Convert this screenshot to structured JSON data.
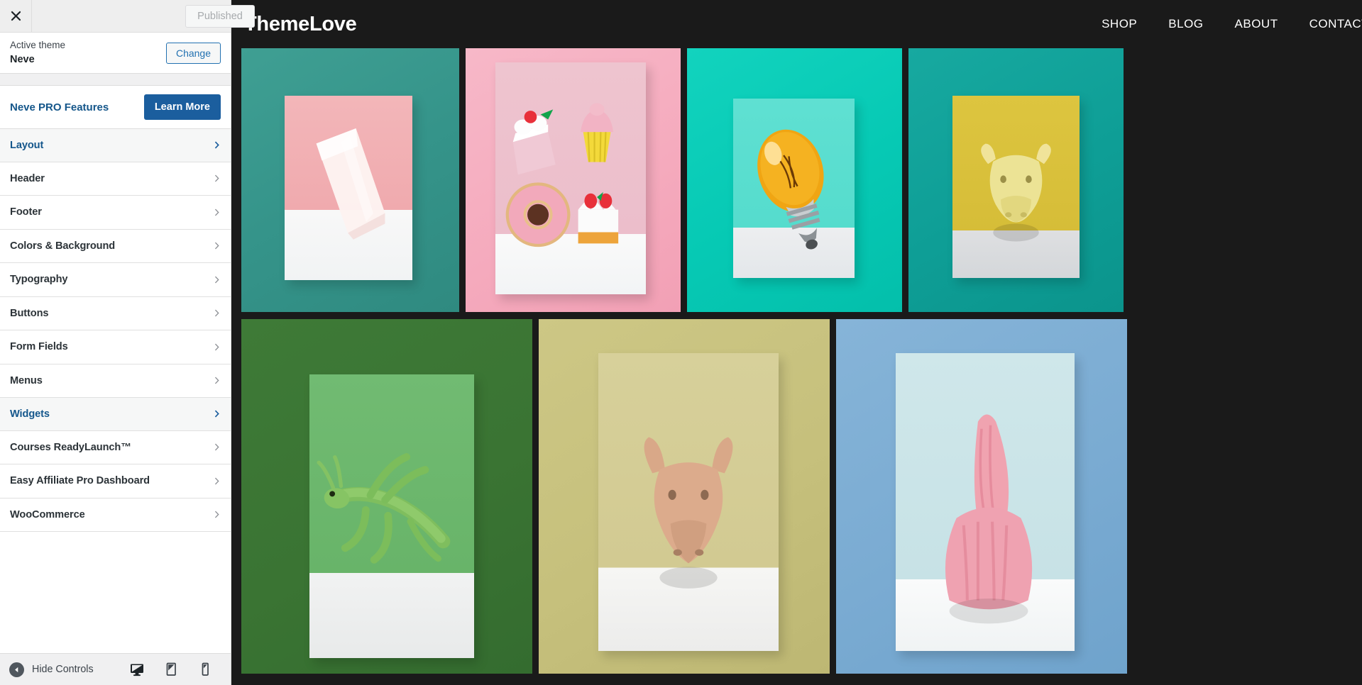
{
  "customizer": {
    "close_icon": "close-x-icon",
    "publish_button": "Published",
    "theme": {
      "label": "Active theme",
      "name": "Neve",
      "change_button": "Change"
    },
    "pro": {
      "label": "Neve PRO Features",
      "button": "Learn More"
    },
    "sections": [
      {
        "label": "Layout",
        "active": true
      },
      {
        "label": "Header",
        "active": false
      },
      {
        "label": "Footer",
        "active": false
      },
      {
        "label": "Colors & Background",
        "active": false
      },
      {
        "label": "Typography",
        "active": false
      },
      {
        "label": "Buttons",
        "active": false
      },
      {
        "label": "Form Fields",
        "active": false
      },
      {
        "label": "Menus",
        "active": false
      },
      {
        "label": "Widgets",
        "active": true
      },
      {
        "label": "Courses ReadyLaunch™",
        "active": false
      },
      {
        "label": "Easy Affiliate Pro Dashboard",
        "active": false
      },
      {
        "label": "WooCommerce",
        "active": false
      }
    ],
    "footer": {
      "hide_controls": "Hide Controls",
      "devices": [
        {
          "name": "desktop-preview-icon",
          "selected": true
        },
        {
          "name": "tablet-preview-icon",
          "selected": false
        },
        {
          "name": "mobile-preview-icon",
          "selected": false
        }
      ]
    }
  },
  "preview": {
    "site_title": "ThemeLove",
    "nav": [
      {
        "label": "SHOP"
      },
      {
        "label": "BLOG"
      },
      {
        "label": "ABOUT"
      },
      {
        "label": "CONTACT"
      }
    ],
    "background_color": "#1a1a1a",
    "gallery": {
      "rows": [
        {
          "tiles": [
            {
              "name": "gallery-tile-rose-quartz",
              "bg_color": "#35948a",
              "subject": "rose quartz stone on pink card"
            },
            {
              "name": "gallery-tile-desserts",
              "bg_color": "#f5aabd",
              "subject": "miniature cakes donut cupcake"
            },
            {
              "name": "gallery-tile-lightbulb",
              "bg_color": "#06c9b4",
              "subject": "orange light bulb on mint card"
            },
            {
              "name": "gallery-tile-bull-head",
              "bg_color": "#0e9e96",
              "subject": "yellow bull head on yellow card"
            }
          ]
        },
        {
          "tiles": [
            {
              "name": "gallery-tile-grasshopper",
              "bg_color": "#3a7433",
              "subject": "green grasshopper on green card"
            },
            {
              "name": "gallery-tile-goat-head",
              "bg_color": "#c6c07c",
              "subject": "beige goat head on sand card"
            },
            {
              "name": "gallery-tile-pink-rabbit",
              "bg_color": "#7aabd2",
              "subject": "pink yarn rabbit on ice card"
            }
          ]
        }
      ]
    }
  }
}
